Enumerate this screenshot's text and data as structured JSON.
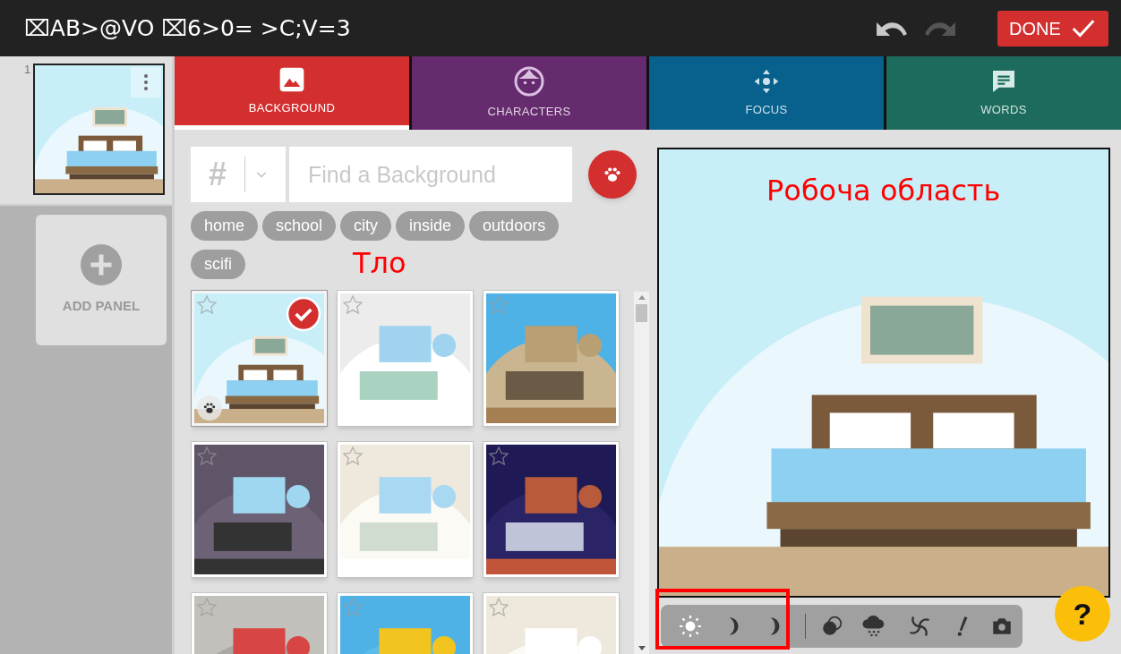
{
  "window": {
    "title": "⌧AB>@VO ⌧6>0= >C;V=3"
  },
  "history": {
    "undo": {
      "disabled": false
    },
    "redo": {
      "disabled": true
    }
  },
  "done_button": {
    "label": "DONE"
  },
  "panels": [
    {
      "number": "1",
      "selected": true,
      "kind": "picture"
    }
  ],
  "add_panel": {
    "label": "ADD PANEL"
  },
  "tabs": [
    {
      "label": "BACKGROUND",
      "selected": true,
      "color": "#d32f2f"
    },
    {
      "label": "CHARACTERS",
      "selected": false,
      "color": "#662a6e"
    },
    {
      "label": "FOCUS",
      "selected": false,
      "color": "#07618c"
    },
    {
      "label": "WORDS",
      "selected": false,
      "color": "#1d6b5c"
    }
  ],
  "search": {
    "hashtag": "#",
    "placeholder": "Find a Background"
  },
  "tags": [
    "home",
    "school",
    "city",
    "inside",
    "outdoors",
    "scifi"
  ],
  "tiles": [
    {
      "kind": "picture",
      "selected": true,
      "paw": true
    },
    {
      "kind": "picture",
      "selected": false,
      "paw": false
    },
    {
      "kind": "picture",
      "selected": false,
      "paw": false
    },
    {
      "kind": "picture",
      "selected": false,
      "paw": false
    },
    {
      "kind": "picture",
      "selected": false,
      "paw": false
    },
    {
      "kind": "picture",
      "selected": false,
      "paw": false
    },
    {
      "kind": "picture",
      "selected": false
    },
    {
      "kind": "picture",
      "selected": false
    },
    {
      "kind": "picture",
      "selected": false
    }
  ],
  "canvas": {
    "kind": "picture"
  },
  "lighting": [
    {
      "selected": true
    },
    {
      "selected": false
    },
    {
      "selected": false
    }
  ],
  "annotations": {
    "canvas_label": "Робоча область",
    "background_label": "Тло",
    "highlight_box": true
  },
  "help_button": {
    "label": "?"
  }
}
